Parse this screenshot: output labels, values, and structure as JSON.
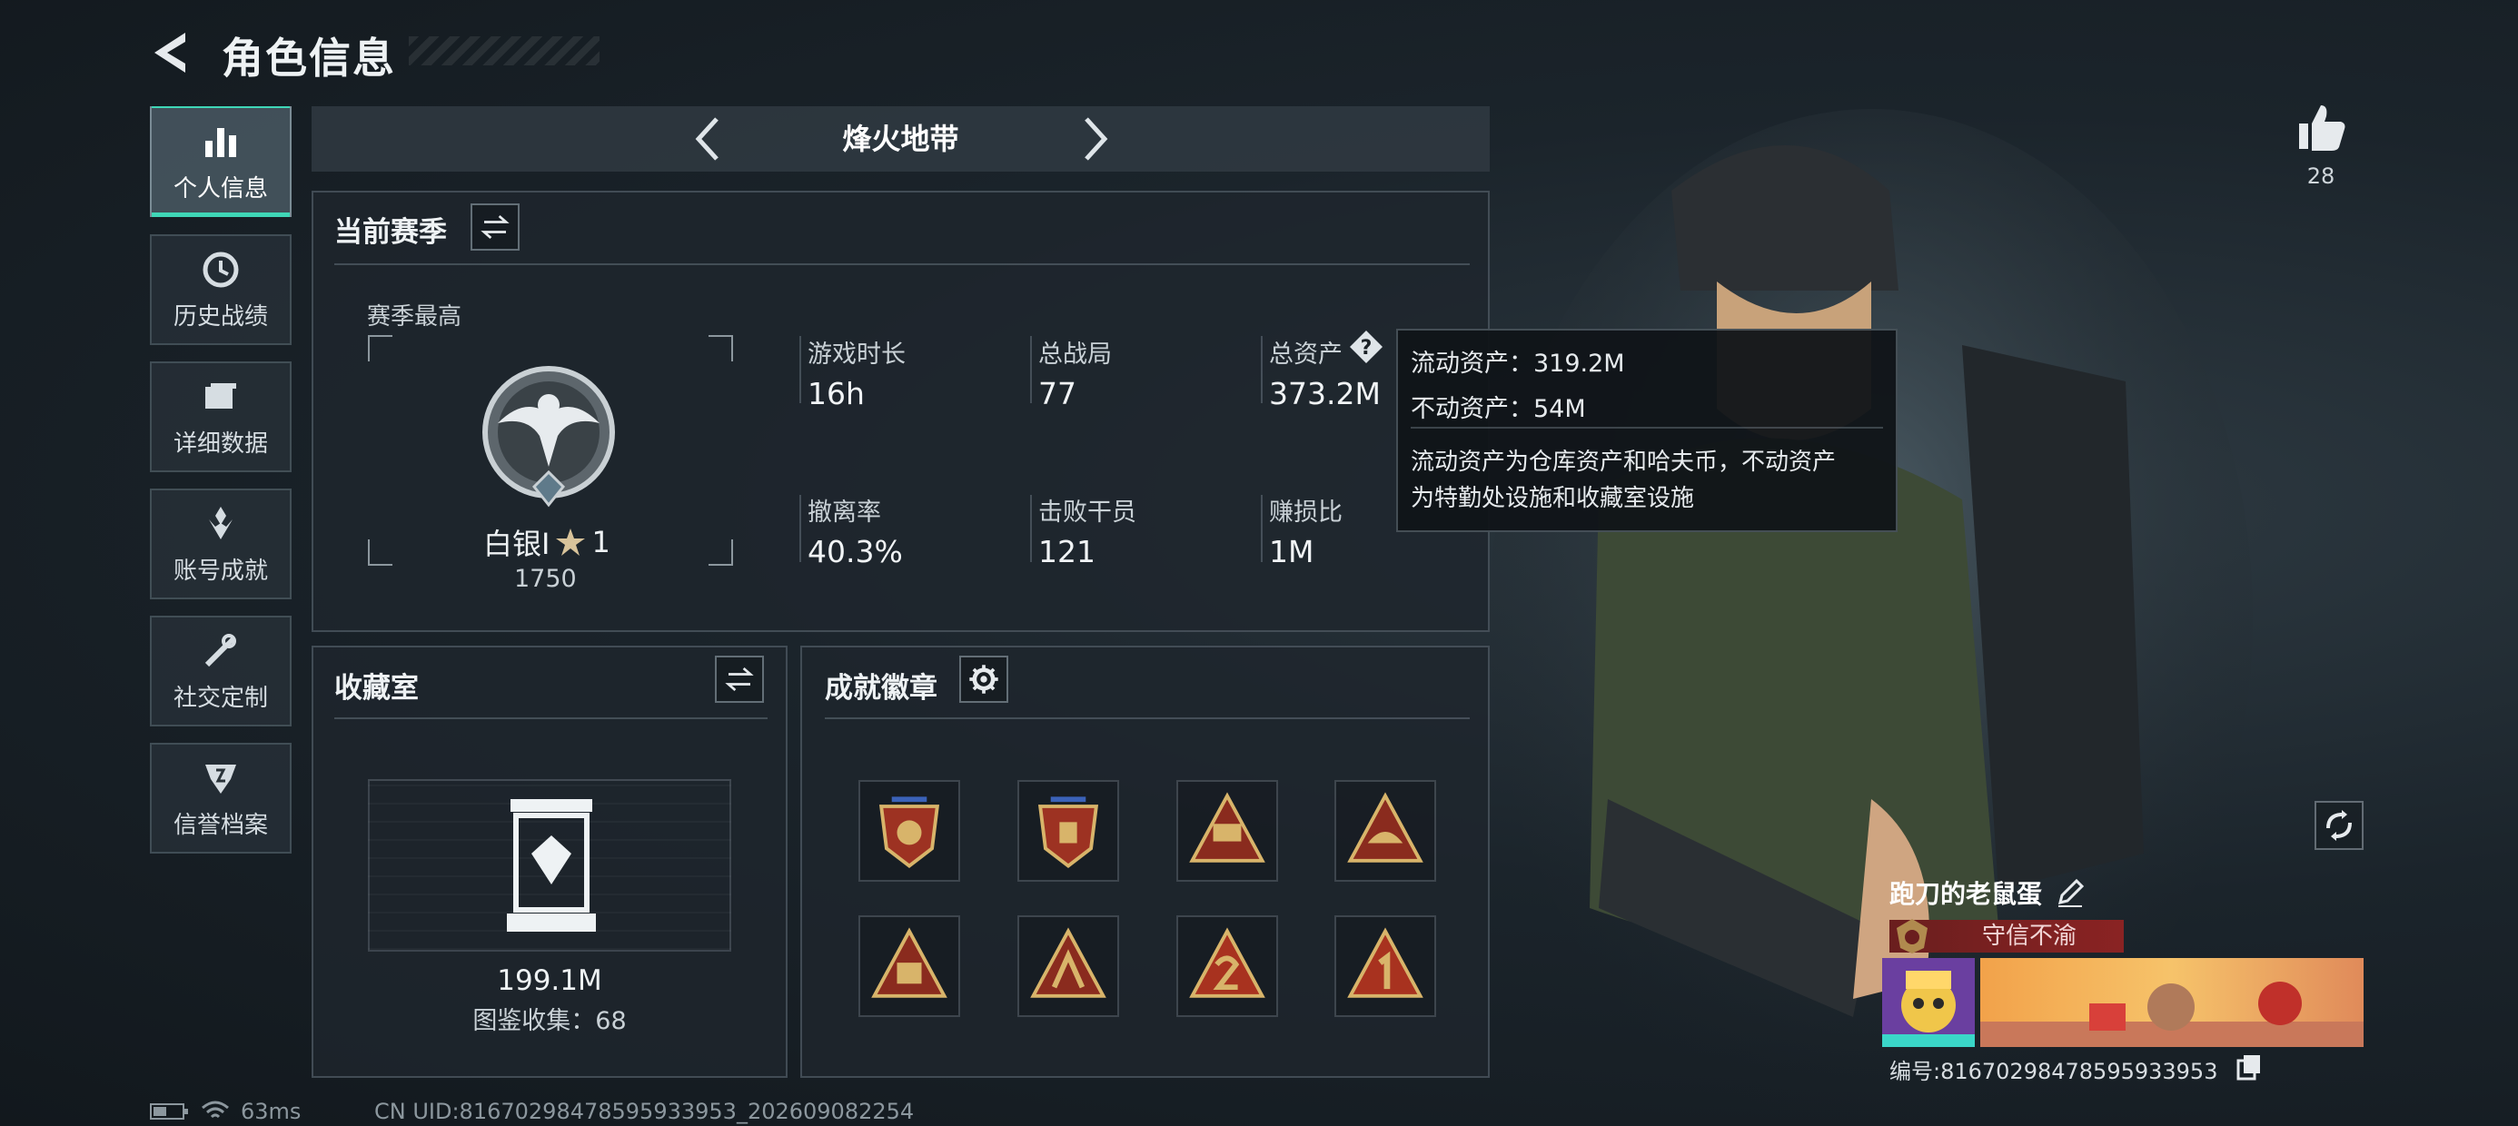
{
  "header": {
    "title": "角色信息"
  },
  "sidebar": {
    "items": [
      {
        "label": "个人信息",
        "icon": "bar-chart-icon",
        "active": true
      },
      {
        "label": "历史战绩",
        "icon": "history-clock-icon"
      },
      {
        "label": "详细数据",
        "icon": "folder-icon"
      },
      {
        "label": "账号成就",
        "icon": "achievement-icon"
      },
      {
        "label": "社交定制",
        "icon": "wrench-icon"
      },
      {
        "label": "信誉档案",
        "icon": "credit-shield-icon"
      }
    ]
  },
  "mode": {
    "title": "烽火地带"
  },
  "season": {
    "title": "当前赛季",
    "best_label": "赛季最高",
    "rank_name": "白银I",
    "rank_stars": "1",
    "rank_score": "1750",
    "stats": [
      {
        "label": "游戏时长",
        "value": "16h"
      },
      {
        "label": "总战局",
        "value": "77"
      },
      {
        "label": "总资产",
        "value": "373.2M"
      },
      {
        "label": "撤离率",
        "value": "40.3%"
      },
      {
        "label": "击败干员",
        "value": "121"
      },
      {
        "label": "赚损比",
        "value": "1M"
      }
    ]
  },
  "tooltip": {
    "liquid": "流动资产：319.2M",
    "fixed": "不动资产：54M",
    "desc_line1": "流动资产为仓库资产和哈夫币，不动资产",
    "desc_line2": "为特勤处设施和收藏室设施"
  },
  "collection": {
    "title": "收藏室",
    "value": "199.1M",
    "count_text": "图鉴收集：68"
  },
  "badges": {
    "title": "成就徽章",
    "items": [
      "badge-1",
      "badge-2",
      "badge-3",
      "badge-4",
      "badge-5",
      "badge-6",
      "badge-7",
      "badge-8"
    ]
  },
  "profile": {
    "likes": "28",
    "name": "跑刀的老鼠蛋",
    "honor": "守信不渝",
    "id_text": "编号:81670298478595933953"
  },
  "footer": {
    "ping": "63ms",
    "uid": "CN UID:81670298478595933953_202609082254"
  },
  "colors": {
    "accent": "#3fd7b7",
    "honor": "#8a2323"
  }
}
